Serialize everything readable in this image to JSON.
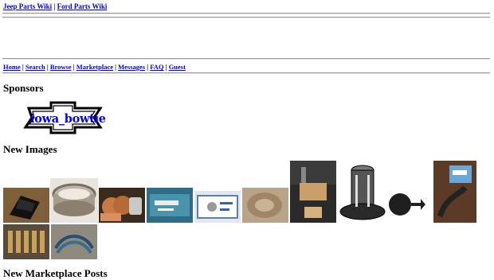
{
  "top_links": [
    "Jeep Parts Wiki",
    "Ford Parts Wiki"
  ],
  "top_separator": " | ",
  "nav": [
    "Home",
    "Search",
    "Browse",
    "Marketplace",
    "Messages",
    "FAQ",
    "Guest"
  ],
  "nav_separator": " | ",
  "sponsors": {
    "heading": "Sponsors",
    "logo_text": "iowa_bowtie"
  },
  "new_images": {
    "heading": "New Images"
  },
  "marketplace": {
    "heading": "New Marketplace Posts"
  }
}
